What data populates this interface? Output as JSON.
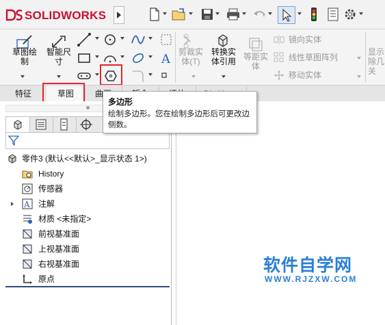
{
  "app": {
    "brand_ds": "3S",
    "brand_name": "SOLIDWORKS"
  },
  "quick_access": [
    "new-file-icon",
    "open-file-icon",
    "save-icon",
    "print-icon",
    "undo-icon",
    "select-cursor-icon",
    "traffic-light-icon",
    "file-properties-icon",
    "options-gear-icon"
  ],
  "command_manager": {
    "sketch_button": {
      "line1": "草图绘",
      "line2": "制"
    },
    "smart_dim_button": {
      "line1": "智能尺",
      "line2": "寸"
    },
    "trim_button": {
      "line1": "剪裁实",
      "line2": "体(T)"
    },
    "convert_button": {
      "line1": "转换实",
      "line2": "体引用"
    },
    "offset_button": {
      "line1": "等距实",
      "line2": "体"
    },
    "mirror_label": "镜向实体",
    "linear_pattern_label": "线性草图阵列",
    "move_label": "移动实体",
    "display_delete": {
      "line1": "显示",
      "line2": "除几",
      "line3": "关"
    }
  },
  "tabs": [
    {
      "label": "特征"
    },
    {
      "label": "草图"
    },
    {
      "label": "曲面"
    },
    {
      "label": "钣金"
    },
    {
      "label": "评估"
    },
    {
      "label": "DimXpert"
    }
  ],
  "tooltip": {
    "title": "多边形",
    "body": "绘制多边形。您在绘制多边形后可更改边侧数。"
  },
  "tree": {
    "root": "零件3 (默认<<默认>_显示状态 1>)",
    "items": [
      {
        "label": "History",
        "icon": "history-folder-icon"
      },
      {
        "label": "传感器",
        "icon": "sensor-icon"
      },
      {
        "label": "注解",
        "icon": "annotation-icon"
      },
      {
        "label": "材质 <未指定>",
        "icon": "material-icon"
      },
      {
        "label": "前视基准面",
        "icon": "plane-icon"
      },
      {
        "label": "上视基准面",
        "icon": "plane-icon"
      },
      {
        "label": "右视基准面",
        "icon": "plane-icon"
      },
      {
        "label": "原点",
        "icon": "origin-icon"
      }
    ]
  },
  "watermark": {
    "title": "软件自学网",
    "url": "WWW.RJZXW.COM"
  },
  "colors": {
    "highlight": "#e8232a",
    "brand_red": "#c8102e",
    "watermark_blue": "#2a7fd6"
  }
}
